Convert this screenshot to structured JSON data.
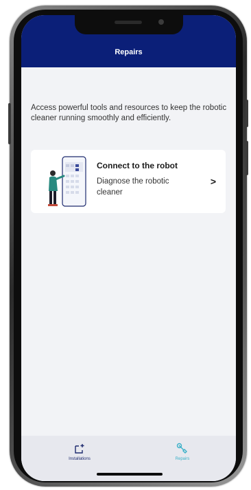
{
  "header": {
    "title": "Repairs"
  },
  "main": {
    "intro": "Access powerful tools and resources to keep the robotic cleaner running smoothly and efficiently.",
    "card": {
      "title": "Connect to the robot",
      "description": "Diagnose the robotic cleaner",
      "chevron": ">"
    }
  },
  "tabbar": {
    "tabs": [
      {
        "label": "Installations",
        "icon": "installations-icon",
        "active": false
      },
      {
        "label": "Repairs",
        "icon": "wrench-icon",
        "active": true
      }
    ]
  },
  "colors": {
    "header": "#0b1f78",
    "accent": "#3ab0c8",
    "tab_inactive": "#1d2a6e"
  }
}
